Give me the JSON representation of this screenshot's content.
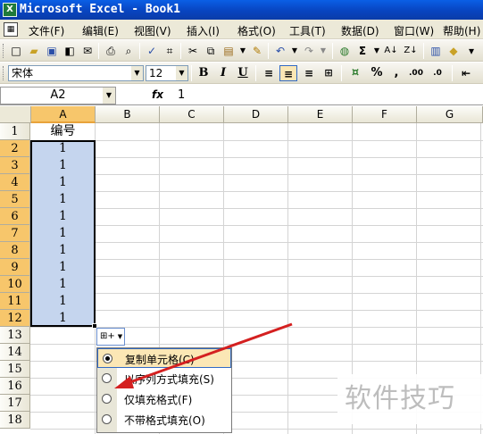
{
  "window": {
    "title": "Microsoft Excel - Book1"
  },
  "menu": [
    "文件(F)",
    "编辑(E)",
    "视图(V)",
    "插入(I)",
    "格式(O)",
    "工具(T)",
    "数据(D)",
    "窗口(W)",
    "帮助(H)"
  ],
  "format_toolbar": {
    "font": "宋体",
    "size": "12",
    "bold": "B",
    "italic": "I",
    "underline": "U",
    "percent": "%",
    "comma": ","
  },
  "formula_bar": {
    "name_box": "A2",
    "fx": "fx",
    "value": "1"
  },
  "columns": [
    "A",
    "B",
    "C",
    "D",
    "E",
    "F",
    "G"
  ],
  "rows": [
    "1",
    "2",
    "3",
    "4",
    "5",
    "6",
    "7",
    "8",
    "9",
    "10",
    "11",
    "12",
    "13",
    "14",
    "15",
    "16",
    "17",
    "18"
  ],
  "cells": {
    "A1": "编号",
    "A2": "1",
    "A3": "1",
    "A4": "1",
    "A5": "1",
    "A6": "1",
    "A7": "1",
    "A8": "1",
    "A9": "1",
    "A10": "1",
    "A11": "1",
    "A12": "1"
  },
  "autofill_options": {
    "selected": 0,
    "items": [
      "复制单元格(C)",
      "以序列方式填充(S)",
      "仅填充格式(F)",
      "不带格式填充(O)"
    ]
  },
  "watermark": "软件技巧",
  "arrow_color": "#d42020",
  "selection_color": "#c5d5ee"
}
